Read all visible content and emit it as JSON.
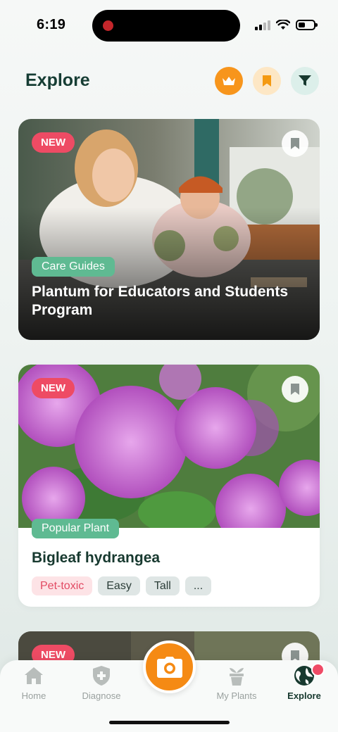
{
  "status_bar": {
    "time": "6:19"
  },
  "header": {
    "title": "Explore"
  },
  "cards": [
    {
      "badge": "NEW",
      "category": "Care Guides",
      "title": "Plantum for Educators and Students Program"
    },
    {
      "badge": "NEW",
      "category": "Popular Plant",
      "title": "Bigleaf hydrangea",
      "tags": [
        "Pet-toxic",
        "Easy",
        "Tall",
        "..."
      ]
    },
    {
      "badge": "NEW"
    }
  ],
  "tab_bar": {
    "tabs": [
      {
        "label": "Home",
        "icon": "home-icon"
      },
      {
        "label": "Diagnose",
        "icon": "shield-plus-icon"
      },
      {
        "label": "My Plants",
        "icon": "potted-plant-icon"
      },
      {
        "label": "Explore",
        "icon": "globe-icon",
        "active": true
      }
    ],
    "center_button_icon": "camera-icon"
  },
  "colors": {
    "accent_orange": "#f58a14",
    "title_green": "#163d34",
    "chip_green": "#5fba92",
    "badge_red": "#ee4b64"
  }
}
